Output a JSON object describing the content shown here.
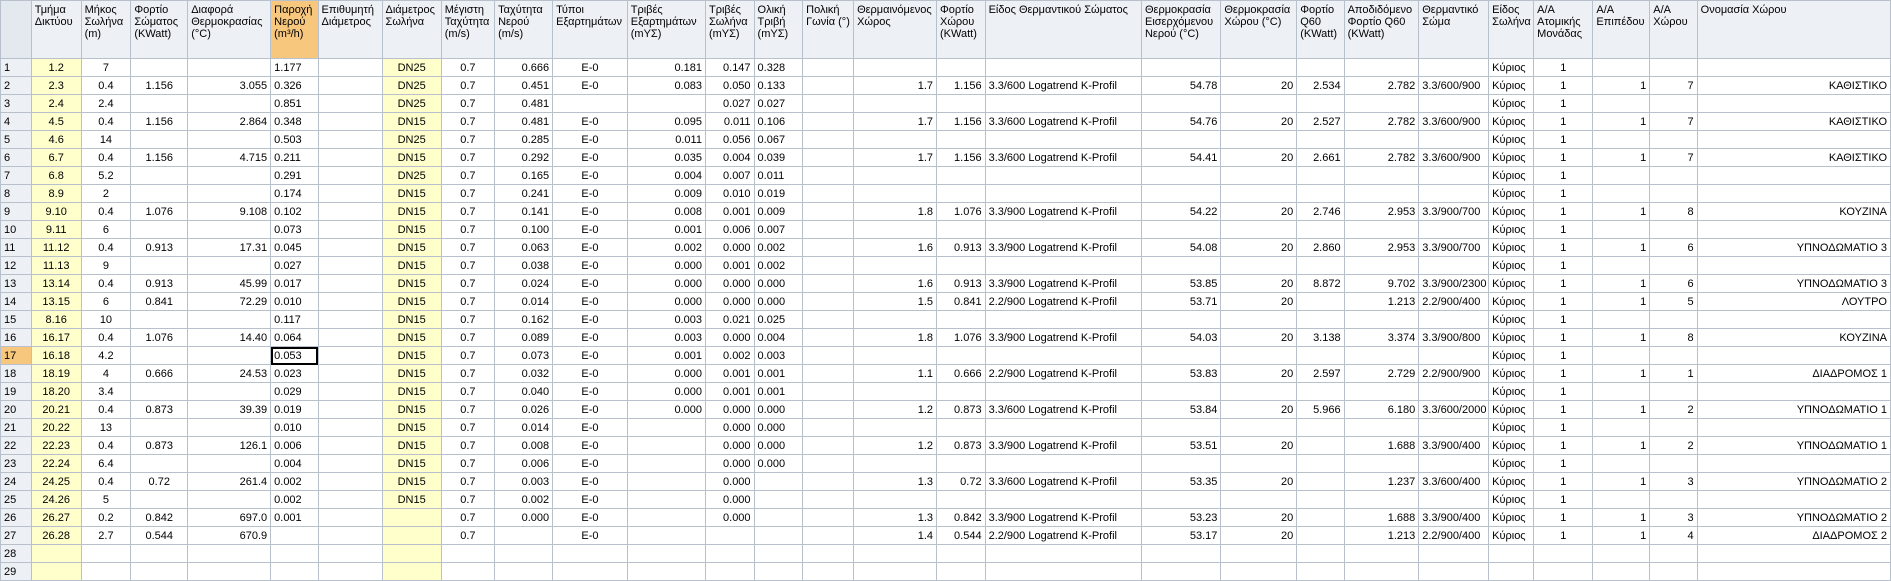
{
  "columns": [
    {
      "key": "c1",
      "label": "Τμήμα Δικτύου",
      "align": "c",
      "yellow": true
    },
    {
      "key": "c2",
      "label": "Μήκος Σωλήνα (m)",
      "align": "c"
    },
    {
      "key": "c3",
      "label": "Φορτίο Σώματος (KWatt)",
      "align": "c"
    },
    {
      "key": "c4",
      "label": "Διαφορά Θερμοκρασίας (°C)",
      "align": "r"
    },
    {
      "key": "c5",
      "label": "Παροχή Νερού (m³/h)",
      "align": "l",
      "selected": true
    },
    {
      "key": "c6",
      "label": "Επιθυμητή Διάμετρος",
      "align": "c"
    },
    {
      "key": "c7",
      "label": "Διάμετρος Σωλήνα",
      "align": "c",
      "yellow": true
    },
    {
      "key": "c8",
      "label": "Μέγιστη Ταχύτητα (m/s)",
      "align": "c"
    },
    {
      "key": "c9",
      "label": "Ταχύτητα Νερού (m/s)",
      "align": "r"
    },
    {
      "key": "c10",
      "label": "Τύποι Εξαρτημάτων",
      "align": "c"
    },
    {
      "key": "c11",
      "label": "Τριβές Εξαρτημάτων (mΥΣ)",
      "align": "r"
    },
    {
      "key": "c12",
      "label": "Τριβές Σωλήνα (mΥΣ)",
      "align": "r"
    },
    {
      "key": "c13",
      "label": "Ολική Τριβή (mΥΣ)",
      "align": "l"
    },
    {
      "key": "c14",
      "label": "Πολική Γωνία (°)",
      "align": "c"
    },
    {
      "key": "c15",
      "label": "Θερμαινόμενος Χώρος",
      "align": "r"
    },
    {
      "key": "c16",
      "label": "Φορτίο Χώρου (KWatt)",
      "align": "r"
    },
    {
      "key": "c17",
      "label": "Είδος Θερμαντικού Σώματος",
      "align": "l"
    },
    {
      "key": "c18",
      "label": "Θερμοκρασία Εισερχόμενου Νερού (°C)",
      "align": "r"
    },
    {
      "key": "c19",
      "label": "Θερμοκρασία Χώρου (°C)",
      "align": "r"
    },
    {
      "key": "c20",
      "label": "Φορτίο Q60 (KWatt)",
      "align": "r"
    },
    {
      "key": "c21",
      "label": "Αποδιδόμενο Φορτίο Q60 (KWatt)",
      "align": "r"
    },
    {
      "key": "c22",
      "label": "Θερμαντικό Σώμα",
      "align": "l"
    },
    {
      "key": "c23",
      "label": "Είδος Σωλήνα",
      "align": "l"
    },
    {
      "key": "c24",
      "label": "Α/Α Ατομικής Μονάδας",
      "align": "c"
    },
    {
      "key": "c25",
      "label": "Α/Α Επιπέδου",
      "align": "r"
    },
    {
      "key": "c26",
      "label": "Α/Α Χώρου",
      "align": "r"
    },
    {
      "key": "c27",
      "label": "Ονομασία Χώρου",
      "align": "r"
    }
  ],
  "active_row": 17,
  "active_col": "c5",
  "rows": [
    {
      "n": "1",
      "c1": "1.2",
      "c2": "7",
      "c3": "",
      "c4": "",
      "c5": "1.177",
      "c6": "",
      "c7": "DN25",
      "c8": "0.7",
      "c9": "0.666",
      "c10": "E-0",
      "c11": "0.181",
      "c12": "0.147",
      "c13": "0.328",
      "c14": "",
      "c15": "",
      "c16": "",
      "c17": "",
      "c18": "",
      "c19": "",
      "c20": "",
      "c21": "",
      "c22": "",
      "c23": "Κύριος",
      "c24": "1",
      "c25": "",
      "c26": "",
      "c27": ""
    },
    {
      "n": "2",
      "c1": "2.3",
      "c2": "0.4",
      "c3": "1.156",
      "c4": "3.055",
      "c5": "0.326",
      "c6": "",
      "c7": "DN25",
      "c8": "0.7",
      "c9": "0.451",
      "c10": "E-0",
      "c11": "0.083",
      "c12": "0.050",
      "c13": "0.133",
      "c14": "",
      "c15": "1.7",
      "c16": "1.156",
      "c17": "3.3/600 Logatrend K-Profil",
      "c18": "54.78",
      "c19": "20",
      "c20": "2.534",
      "c21": "2.782",
      "c22": "3.3/600/900",
      "c23": "Κύριος",
      "c24": "1",
      "c25": "1",
      "c26": "7",
      "c27": "ΚΑΘΙΣΤΙΚΟ"
    },
    {
      "n": "3",
      "c1": "2.4",
      "c2": "2.4",
      "c3": "",
      "c4": "",
      "c5": "0.851",
      "c6": "",
      "c7": "DN25",
      "c8": "0.7",
      "c9": "0.481",
      "c10": "",
      "c11": "",
      "c12": "0.027",
      "c13": "0.027",
      "c14": "",
      "c15": "",
      "c16": "",
      "c17": "",
      "c18": "",
      "c19": "",
      "c20": "",
      "c21": "",
      "c22": "",
      "c23": "Κύριος",
      "c24": "1",
      "c25": "",
      "c26": "",
      "c27": ""
    },
    {
      "n": "4",
      "c1": "4.5",
      "c2": "0.4",
      "c3": "1.156",
      "c4": "2.864",
      "c5": "0.348",
      "c6": "",
      "c7": "DN15",
      "c8": "0.7",
      "c9": "0.481",
      "c10": "E-0",
      "c11": "0.095",
      "c12": "0.011",
      "c13": "0.106",
      "c14": "",
      "c15": "1.7",
      "c16": "1.156",
      "c17": "3.3/600 Logatrend K-Profil",
      "c18": "54.76",
      "c19": "20",
      "c20": "2.527",
      "c21": "2.782",
      "c22": "3.3/600/900",
      "c23": "Κύριος",
      "c24": "1",
      "c25": "1",
      "c26": "7",
      "c27": "ΚΑΘΙΣΤΙΚΟ"
    },
    {
      "n": "5",
      "c1": "4.6",
      "c2": "14",
      "c3": "",
      "c4": "",
      "c5": "0.503",
      "c6": "",
      "c7": "DN25",
      "c8": "0.7",
      "c9": "0.285",
      "c10": "E-0",
      "c11": "0.011",
      "c12": "0.056",
      "c13": "0.067",
      "c14": "",
      "c15": "",
      "c16": "",
      "c17": "",
      "c18": "",
      "c19": "",
      "c20": "",
      "c21": "",
      "c22": "",
      "c23": "Κύριος",
      "c24": "1",
      "c25": "",
      "c26": "",
      "c27": ""
    },
    {
      "n": "6",
      "c1": "6.7",
      "c2": "0.4",
      "c3": "1.156",
      "c4": "4.715",
      "c5": "0.211",
      "c6": "",
      "c7": "DN15",
      "c8": "0.7",
      "c9": "0.292",
      "c10": "E-0",
      "c11": "0.035",
      "c12": "0.004",
      "c13": "0.039",
      "c14": "",
      "c15": "1.7",
      "c16": "1.156",
      "c17": "3.3/600 Logatrend K-Profil",
      "c18": "54.41",
      "c19": "20",
      "c20": "2.661",
      "c21": "2.782",
      "c22": "3.3/600/900",
      "c23": "Κύριος",
      "c24": "1",
      "c25": "1",
      "c26": "7",
      "c27": "ΚΑΘΙΣΤΙΚΟ"
    },
    {
      "n": "7",
      "c1": "6.8",
      "c2": "5.2",
      "c3": "",
      "c4": "",
      "c5": "0.291",
      "c6": "",
      "c7": "DN25",
      "c8": "0.7",
      "c9": "0.165",
      "c10": "E-0",
      "c11": "0.004",
      "c12": "0.007",
      "c13": "0.011",
      "c14": "",
      "c15": "",
      "c16": "",
      "c17": "",
      "c18": "",
      "c19": "",
      "c20": "",
      "c21": "",
      "c22": "",
      "c23": "Κύριος",
      "c24": "1",
      "c25": "",
      "c26": "",
      "c27": ""
    },
    {
      "n": "8",
      "c1": "8.9",
      "c2": "2",
      "c3": "",
      "c4": "",
      "c5": "0.174",
      "c6": "",
      "c7": "DN15",
      "c8": "0.7",
      "c9": "0.241",
      "c10": "E-0",
      "c11": "0.009",
      "c12": "0.010",
      "c13": "0.019",
      "c14": "",
      "c15": "",
      "c16": "",
      "c17": "",
      "c18": "",
      "c19": "",
      "c20": "",
      "c21": "",
      "c22": "",
      "c23": "Κύριος",
      "c24": "1",
      "c25": "",
      "c26": "",
      "c27": ""
    },
    {
      "n": "9",
      "c1": "9.10",
      "c2": "0.4",
      "c3": "1.076",
      "c4": "9.108",
      "c5": "0.102",
      "c6": "",
      "c7": "DN15",
      "c8": "0.7",
      "c9": "0.141",
      "c10": "E-0",
      "c11": "0.008",
      "c12": "0.001",
      "c13": "0.009",
      "c14": "",
      "c15": "1.8",
      "c16": "1.076",
      "c17": "3.3/900 Logatrend K-Profil",
      "c18": "54.22",
      "c19": "20",
      "c20": "2.746",
      "c21": "2.953",
      "c22": "3.3/900/700",
      "c23": "Κύριος",
      "c24": "1",
      "c25": "1",
      "c26": "8",
      "c27": "ΚΟΥΖΙΝΑ"
    },
    {
      "n": "10",
      "c1": "9.11",
      "c2": "6",
      "c3": "",
      "c4": "",
      "c5": "0.073",
      "c6": "",
      "c7": "DN15",
      "c8": "0.7",
      "c9": "0.100",
      "c10": "E-0",
      "c11": "0.001",
      "c12": "0.006",
      "c13": "0.007",
      "c14": "",
      "c15": "",
      "c16": "",
      "c17": "",
      "c18": "",
      "c19": "",
      "c20": "",
      "c21": "",
      "c22": "",
      "c23": "Κύριος",
      "c24": "1",
      "c25": "",
      "c26": "",
      "c27": ""
    },
    {
      "n": "11",
      "c1": "11.12",
      "c2": "0.4",
      "c3": "0.913",
      "c4": "17.31",
      "c5": "0.045",
      "c6": "",
      "c7": "DN15",
      "c8": "0.7",
      "c9": "0.063",
      "c10": "E-0",
      "c11": "0.002",
      "c12": "0.000",
      "c13": "0.002",
      "c14": "",
      "c15": "1.6",
      "c16": "0.913",
      "c17": "3.3/900 Logatrend K-Profil",
      "c18": "54.08",
      "c19": "20",
      "c20": "2.860",
      "c21": "2.953",
      "c22": "3.3/900/700",
      "c23": "Κύριος",
      "c24": "1",
      "c25": "1",
      "c26": "6",
      "c27": "ΥΠΝΟΔΩΜΑΤΙΟ 3"
    },
    {
      "n": "12",
      "c1": "11.13",
      "c2": "9",
      "c3": "",
      "c4": "",
      "c5": "0.027",
      "c6": "",
      "c7": "DN15",
      "c8": "0.7",
      "c9": "0.038",
      "c10": "E-0",
      "c11": "0.000",
      "c12": "0.001",
      "c13": "0.002",
      "c14": "",
      "c15": "",
      "c16": "",
      "c17": "",
      "c18": "",
      "c19": "",
      "c20": "",
      "c21": "",
      "c22": "",
      "c23": "Κύριος",
      "c24": "1",
      "c25": "",
      "c26": "",
      "c27": ""
    },
    {
      "n": "13",
      "c1": "13.14",
      "c2": "0.4",
      "c3": "0.913",
      "c4": "45.99",
      "c5": "0.017",
      "c6": "",
      "c7": "DN15",
      "c8": "0.7",
      "c9": "0.024",
      "c10": "E-0",
      "c11": "0.000",
      "c12": "0.000",
      "c13": "0.000",
      "c14": "",
      "c15": "1.6",
      "c16": "0.913",
      "c17": "3.3/900 Logatrend K-Profil",
      "c18": "53.85",
      "c19": "20",
      "c20": "8.872",
      "c21": "9.702",
      "c22": "3.3/900/2300",
      "c23": "Κύριος",
      "c24": "1",
      "c25": "1",
      "c26": "6",
      "c27": "ΥΠΝΟΔΩΜΑΤΙΟ 3"
    },
    {
      "n": "14",
      "c1": "13.15",
      "c2": "6",
      "c3": "0.841",
      "c4": "72.29",
      "c5": "0.010",
      "c6": "",
      "c7": "DN15",
      "c8": "0.7",
      "c9": "0.014",
      "c10": "E-0",
      "c11": "0.000",
      "c12": "0.000",
      "c13": "0.000",
      "c14": "",
      "c15": "1.5",
      "c16": "0.841",
      "c17": "2.2/900 Logatrend K-Profil",
      "c18": "53.71",
      "c19": "20",
      "c20": "",
      "c21": "1.213",
      "c22": "2.2/900/400",
      "c23": "Κύριος",
      "c24": "1",
      "c25": "1",
      "c26": "5",
      "c27": "ΛΟΥΤΡΟ"
    },
    {
      "n": "15",
      "c1": "8.16",
      "c2": "10",
      "c3": "",
      "c4": "",
      "c5": "0.117",
      "c6": "",
      "c7": "DN15",
      "c8": "0.7",
      "c9": "0.162",
      "c10": "E-0",
      "c11": "0.003",
      "c12": "0.021",
      "c13": "0.025",
      "c14": "",
      "c15": "",
      "c16": "",
      "c17": "",
      "c18": "",
      "c19": "",
      "c20": "",
      "c21": "",
      "c22": "",
      "c23": "Κύριος",
      "c24": "1",
      "c25": "",
      "c26": "",
      "c27": ""
    },
    {
      "n": "16",
      "c1": "16.17",
      "c2": "0.4",
      "c3": "1.076",
      "c4": "14.40",
      "c5": "0.064",
      "c6": "",
      "c7": "DN15",
      "c8": "0.7",
      "c9": "0.089",
      "c10": "E-0",
      "c11": "0.003",
      "c12": "0.000",
      "c13": "0.004",
      "c14": "",
      "c15": "1.8",
      "c16": "1.076",
      "c17": "3.3/900 Logatrend K-Profil",
      "c18": "54.03",
      "c19": "20",
      "c20": "3.138",
      "c21": "3.374",
      "c22": "3.3/900/800",
      "c23": "Κύριος",
      "c24": "1",
      "c25": "1",
      "c26": "8",
      "c27": "ΚΟΥΖΙΝΑ"
    },
    {
      "n": "17",
      "c1": "16.18",
      "c2": "4.2",
      "c3": "",
      "c4": "",
      "c5": "0.053",
      "c6": "",
      "c7": "DN15",
      "c8": "0.7",
      "c9": "0.073",
      "c10": "E-0",
      "c11": "0.001",
      "c12": "0.002",
      "c13": "0.003",
      "c14": "",
      "c15": "",
      "c16": "",
      "c17": "",
      "c18": "",
      "c19": "",
      "c20": "",
      "c21": "",
      "c22": "",
      "c23": "Κύριος",
      "c24": "1",
      "c25": "",
      "c26": "",
      "c27": ""
    },
    {
      "n": "18",
      "c1": "18.19",
      "c2": "4",
      "c3": "0.666",
      "c4": "24.53",
      "c5": "0.023",
      "c6": "",
      "c7": "DN15",
      "c8": "0.7",
      "c9": "0.032",
      "c10": "E-0",
      "c11": "0.000",
      "c12": "0.001",
      "c13": "0.001",
      "c14": "",
      "c15": "1.1",
      "c16": "0.666",
      "c17": "2.2/900 Logatrend K-Profil",
      "c18": "53.83",
      "c19": "20",
      "c20": "2.597",
      "c21": "2.729",
      "c22": "2.2/900/900",
      "c23": "Κύριος",
      "c24": "1",
      "c25": "1",
      "c26": "1",
      "c27": "ΔΙΑΔΡΟΜΟΣ 1"
    },
    {
      "n": "19",
      "c1": "18.20",
      "c2": "3.4",
      "c3": "",
      "c4": "",
      "c5": "0.029",
      "c6": "",
      "c7": "DN15",
      "c8": "0.7",
      "c9": "0.040",
      "c10": "E-0",
      "c11": "0.000",
      "c12": "0.001",
      "c13": "0.001",
      "c14": "",
      "c15": "",
      "c16": "",
      "c17": "",
      "c18": "",
      "c19": "",
      "c20": "",
      "c21": "",
      "c22": "",
      "c23": "Κύριος",
      "c24": "1",
      "c25": "",
      "c26": "",
      "c27": ""
    },
    {
      "n": "20",
      "c1": "20.21",
      "c2": "0.4",
      "c3": "0.873",
      "c4": "39.39",
      "c5": "0.019",
      "c6": "",
      "c7": "DN15",
      "c8": "0.7",
      "c9": "0.026",
      "c10": "E-0",
      "c11": "0.000",
      "c12": "0.000",
      "c13": "0.000",
      "c14": "",
      "c15": "1.2",
      "c16": "0.873",
      "c17": "3.3/600 Logatrend K-Profil",
      "c18": "53.84",
      "c19": "20",
      "c20": "5.966",
      "c21": "6.180",
      "c22": "3.3/600/2000",
      "c23": "Κύριος",
      "c24": "1",
      "c25": "1",
      "c26": "2",
      "c27": "ΥΠΝΟΔΩΜΑΤΙΟ 1"
    },
    {
      "n": "21",
      "c1": "20.22",
      "c2": "13",
      "c3": "",
      "c4": "",
      "c5": "0.010",
      "c6": "",
      "c7": "DN15",
      "c8": "0.7",
      "c9": "0.014",
      "c10": "E-0",
      "c11": "",
      "c12": "0.000",
      "c13": "0.000",
      "c14": "",
      "c15": "",
      "c16": "",
      "c17": "",
      "c18": "",
      "c19": "",
      "c20": "",
      "c21": "",
      "c22": "",
      "c23": "Κύριος",
      "c24": "1",
      "c25": "",
      "c26": "",
      "c27": ""
    },
    {
      "n": "22",
      "c1": "22.23",
      "c2": "0.4",
      "c3": "0.873",
      "c4": "126.1",
      "c5": "0.006",
      "c6": "",
      "c7": "DN15",
      "c8": "0.7",
      "c9": "0.008",
      "c10": "E-0",
      "c11": "",
      "c12": "0.000",
      "c13": "0.000",
      "c14": "",
      "c15": "1.2",
      "c16": "0.873",
      "c17": "3.3/900 Logatrend K-Profil",
      "c18": "53.51",
      "c19": "20",
      "c20": "",
      "c21": "1.688",
      "c22": "3.3/900/400",
      "c23": "Κύριος",
      "c24": "1",
      "c25": "1",
      "c26": "2",
      "c27": "ΥΠΝΟΔΩΜΑΤΙΟ 1"
    },
    {
      "n": "23",
      "c1": "22.24",
      "c2": "6.4",
      "c3": "",
      "c4": "",
      "c5": "0.004",
      "c6": "",
      "c7": "DN15",
      "c8": "0.7",
      "c9": "0.006",
      "c10": "E-0",
      "c11": "",
      "c12": "0.000",
      "c13": "0.000",
      "c14": "",
      "c15": "",
      "c16": "",
      "c17": "",
      "c18": "",
      "c19": "",
      "c20": "",
      "c21": "",
      "c22": "",
      "c23": "Κύριος",
      "c24": "1",
      "c25": "",
      "c26": "",
      "c27": ""
    },
    {
      "n": "24",
      "c1": "24.25",
      "c2": "0.4",
      "c3": "0.72",
      "c4": "261.4",
      "c5": "0.002",
      "c6": "",
      "c7": "DN15",
      "c8": "0.7",
      "c9": "0.003",
      "c10": "E-0",
      "c11": "",
      "c12": "0.000",
      "c13": "",
      "c14": "",
      "c15": "1.3",
      "c16": "0.72",
      "c17": "3.3/600 Logatrend K-Profil",
      "c18": "53.35",
      "c19": "20",
      "c20": "",
      "c21": "1.237",
      "c22": "3.3/600/400",
      "c23": "Κύριος",
      "c24": "1",
      "c25": "1",
      "c26": "3",
      "c27": "ΥΠΝΟΔΩΜΑΤΙΟ 2"
    },
    {
      "n": "25",
      "c1": "24.26",
      "c2": "5",
      "c3": "",
      "c4": "",
      "c5": "0.002",
      "c6": "",
      "c7": "DN15",
      "c8": "0.7",
      "c9": "0.002",
      "c10": "E-0",
      "c11": "",
      "c12": "0.000",
      "c13": "",
      "c14": "",
      "c15": "",
      "c16": "",
      "c17": "",
      "c18": "",
      "c19": "",
      "c20": "",
      "c21": "",
      "c22": "",
      "c23": "Κύριος",
      "c24": "1",
      "c25": "",
      "c26": "",
      "c27": ""
    },
    {
      "n": "26",
      "c1": "26.27",
      "c2": "0.2",
      "c3": "0.842",
      "c4": "697.0",
      "c5": "0.001",
      "c6": "",
      "c7": "",
      "c8": "0.7",
      "c9": "0.000",
      "c10": "E-0",
      "c11": "",
      "c12": "0.000",
      "c13": "",
      "c14": "",
      "c15": "1.3",
      "c16": "0.842",
      "c17": "3.3/900 Logatrend K-Profil",
      "c18": "53.23",
      "c19": "20",
      "c20": "",
      "c21": "1.688",
      "c22": "3.3/900/400",
      "c23": "Κύριος",
      "c24": "1",
      "c25": "1",
      "c26": "3",
      "c27": "ΥΠΝΟΔΩΜΑΤΙΟ 2"
    },
    {
      "n": "27",
      "c1": "26.28",
      "c2": "2.7",
      "c3": "0.544",
      "c4": "670.9",
      "c5": "",
      "c6": "",
      "c7": "",
      "c8": "0.7",
      "c9": "",
      "c10": "E-0",
      "c11": "",
      "c12": "",
      "c13": "",
      "c14": "",
      "c15": "1.4",
      "c16": "0.544",
      "c17": "2.2/900 Logatrend K-Profil",
      "c18": "53.17",
      "c19": "20",
      "c20": "",
      "c21": "1.213",
      "c22": "2.2/900/400",
      "c23": "Κύριος",
      "c24": "1",
      "c25": "1",
      "c26": "4",
      "c27": "ΔΙΑΔΡΟΜΟΣ 2"
    },
    {
      "n": "28",
      "c1": "",
      "c2": "",
      "c3": "",
      "c4": "",
      "c5": "",
      "c6": "",
      "c7": "",
      "c8": "",
      "c9": "",
      "c10": "",
      "c11": "",
      "c12": "",
      "c13": "",
      "c14": "",
      "c15": "",
      "c16": "",
      "c17": "",
      "c18": "",
      "c19": "",
      "c20": "",
      "c21": "",
      "c22": "",
      "c23": "",
      "c24": "",
      "c25": "",
      "c26": "",
      "c27": ""
    },
    {
      "n": "29",
      "c1": "",
      "c2": "",
      "c3": "",
      "c4": "",
      "c5": "",
      "c6": "",
      "c7": "",
      "c8": "",
      "c9": "",
      "c10": "",
      "c11": "",
      "c12": "",
      "c13": "",
      "c14": "",
      "c15": "",
      "c16": "",
      "c17": "",
      "c18": "",
      "c19": "",
      "c20": "",
      "c21": "",
      "c22": "",
      "c23": "",
      "c24": "",
      "c25": "",
      "c26": "",
      "c27": ""
    }
  ]
}
